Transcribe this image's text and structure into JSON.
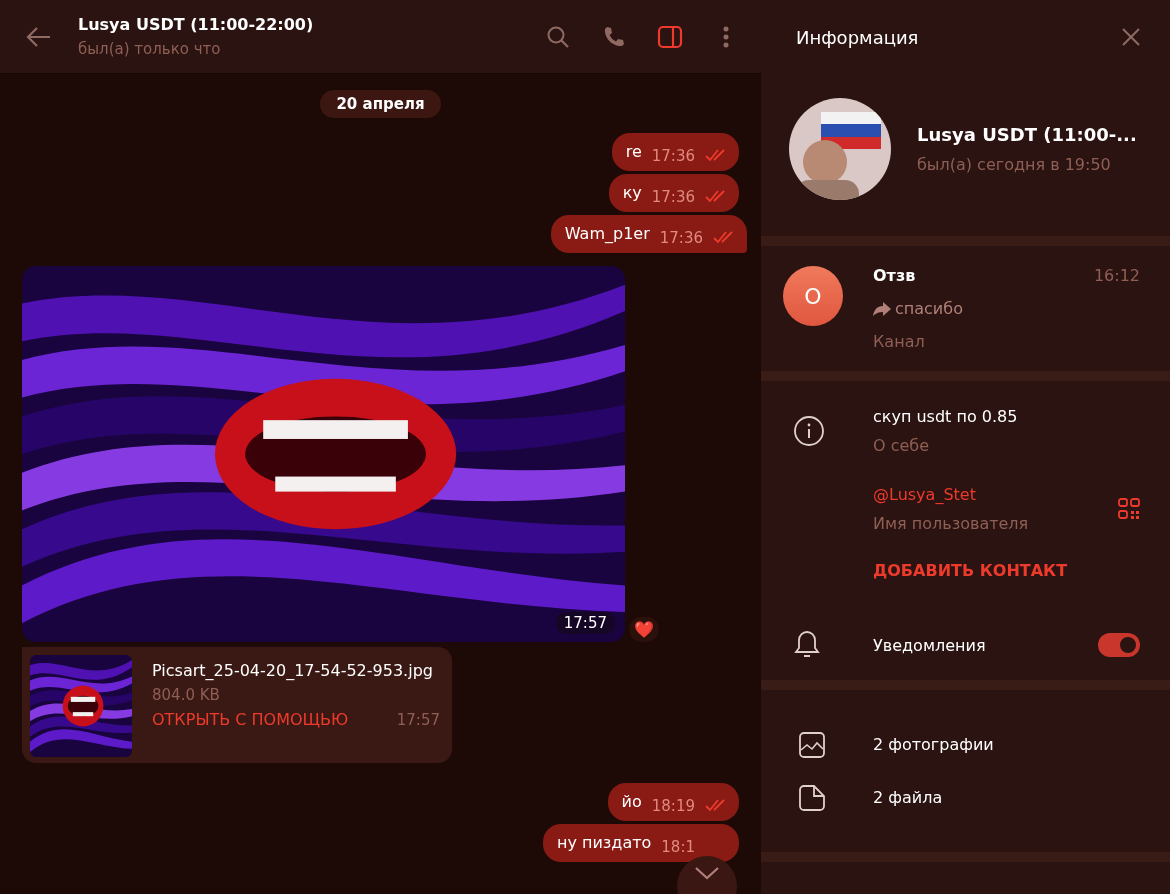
{
  "chat_header": {
    "title": "Lusya USDT (11:00-22:00)",
    "status": "был(а) только что",
    "sidebar_toggle_on": true
  },
  "date_chip": "20 апреля",
  "messages": [
    {
      "kind": "text",
      "text": "re",
      "time": "17:36",
      "read": true
    },
    {
      "kind": "text",
      "text": "ку",
      "time": "17:36",
      "read": true
    },
    {
      "kind": "text",
      "text": "Wam_p1er",
      "time": "17:36",
      "read": true,
      "tail": true
    },
    {
      "time": "17:57",
      "reaction": "❤️"
    },
    {
      "kind": "file",
      "name": "Picsart_25-04-20_17-54-52-953.jpg",
      "size": "804.0 KB",
      "action": "ОТКРЫТЬ С ПОМОЩЬЮ",
      "time": "17:57"
    },
    {
      "kind": "text",
      "text": "йо",
      "time": "18:19",
      "read": true
    },
    {
      "kind": "text",
      "text": "ну пиздато",
      "time": "18:1",
      "read": false
    }
  ],
  "info_panel": {
    "title": "Информация",
    "profile": {
      "name": "Lusya USDT (11:00-...",
      "status": "был(а) сегодня в 19:50"
    },
    "channel": {
      "avatar_letter": "О",
      "name": "Отзв",
      "time": "16:12",
      "last_message": "спасибо",
      "type": "Канал"
    },
    "about": {
      "value": "скуп usdt по 0.85",
      "label": "О себе"
    },
    "username": {
      "value": "@Lusya_Stet",
      "label": "Имя пользователя"
    },
    "add_contact": "ДОБАВИТЬ КОНТАКТ",
    "notifications": {
      "label": "Уведомления",
      "on": true
    },
    "media": [
      {
        "kind": "photos",
        "label": "2 фотографии"
      },
      {
        "kind": "files",
        "label": "2 файла"
      }
    ]
  }
}
